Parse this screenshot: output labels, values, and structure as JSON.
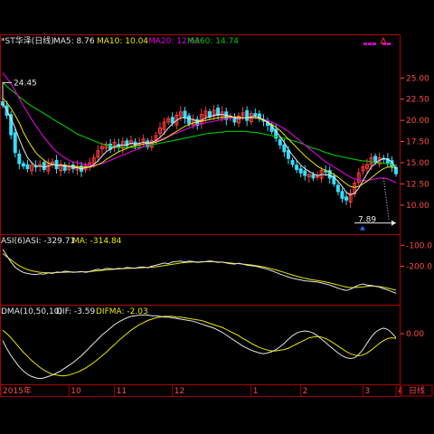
{
  "colors": {
    "up": "#ff3b3b",
    "down": "#32e0ff",
    "frame": "#a80000",
    "axis": "#ff4a4a",
    "white": "#e6e6e6",
    "yellow": "#e8e800",
    "magenta": "#e000e0",
    "green": "#00c800"
  },
  "top": {
    "stock_name": "*ST华泽(日线)",
    "ma_items": [
      {
        "label": "MA5: 8.76",
        "color": "#e6e6e6"
      },
      {
        "label": "MA10: 10.04",
        "color": "#e8e800"
      },
      {
        "label": "MA20: 12.63",
        "color": "#e000e0"
      },
      {
        "label": "MA60: 14.74",
        "color": "#00c800"
      }
    ]
  },
  "asi_panel": {
    "title": "ASI(6)",
    "asi_label": "ASI: -329.71",
    "ma_label": "MA: -314.84"
  },
  "dma_panel": {
    "title": "DMA(10,50,10)",
    "dif_label": "DIF: -3.59",
    "difma_label": "DIFMA: -2.03"
  },
  "x_axis": {
    "labels": [
      "2015年",
      "10",
      "11",
      "12",
      "1",
      "2",
      "3",
      "4"
    ],
    "period_label": "日线"
  },
  "chart_data": [
    {
      "type": "candlestick",
      "title": "*ST华泽(日线)",
      "y_ticks": [
        "25.00",
        "22.50",
        "20.00",
        "17.50",
        "15.00",
        "12.50",
        "10.00"
      ],
      "ylim": [
        7.0,
        27.8
      ],
      "annotations": {
        "high": "24.45",
        "low": "7.89"
      },
      "close": [
        21.8,
        20.6,
        18.3,
        16.2,
        14.9,
        14.6,
        14.3,
        14.7,
        14.5,
        14.8,
        14.2,
        14.9,
        15.1,
        14.3,
        14.8,
        14.1,
        14.5,
        14.3,
        14.6,
        14.0,
        14.7,
        15.0,
        15.6,
        16.4,
        16.9,
        17.2,
        16.6,
        17.4,
        16.8,
        17.5,
        17.0,
        17.6,
        17.1,
        17.3,
        17.8,
        16.9,
        17.6,
        18.2,
        19.1,
        19.8,
        20.2,
        19.7,
        20.6,
        21.0,
        20.3,
        19.6,
        20.1,
        19.4,
        20.7,
        21.1,
        20.4,
        21.2,
        20.6,
        21.0,
        20.1,
        20.5,
        19.8,
        20.5,
        20.9,
        20.0,
        20.8,
        20.6,
        20.3,
        19.9,
        19.4,
        18.7,
        17.9,
        17.1,
        16.3,
        15.5,
        14.8,
        14.2,
        13.8,
        13.5,
        13.6,
        13.2,
        13.4,
        14.1,
        14.0,
        13.2,
        12.5,
        11.6,
        10.8,
        10.6,
        11.4,
        12.6,
        13.8,
        14.5,
        14.8,
        15.6,
        15.1,
        15.6,
        15.4,
        15.0,
        14.6,
        13.7
      ],
      "ma5": [
        21.9,
        21.2,
        20.2,
        19.1,
        17.8,
        16.6,
        15.6,
        15.0,
        14.6,
        14.6,
        14.5,
        14.6,
        14.8,
        14.7,
        14.7,
        14.6,
        14.6,
        14.5,
        14.4,
        14.3,
        14.4,
        14.5,
        14.8,
        15.2,
        15.8,
        16.3,
        16.6,
        16.9,
        17.0,
        17.1,
        17.1,
        17.3,
        17.2,
        17.3,
        17.4,
        17.3,
        17.4,
        17.6,
        18.0,
        18.5,
        19.1,
        19.6,
        20.0,
        20.3,
        20.3,
        20.2,
        20.1,
        19.9,
        20.0,
        20.3,
        20.4,
        20.6,
        20.7,
        20.7,
        20.6,
        20.5,
        20.3,
        20.2,
        20.3,
        20.3,
        20.4,
        20.5,
        20.3,
        20.1,
        19.8,
        19.3,
        18.7,
        18.1,
        17.4,
        16.6,
        15.9,
        15.3,
        14.7,
        14.3,
        14.0,
        13.7,
        13.5,
        13.6,
        13.6,
        13.5,
        13.3,
        12.8,
        12.2,
        11.5,
        11.2,
        11.4,
        12.0,
        12.9,
        13.7,
        14.5,
        14.9,
        15.3,
        15.5,
        15.4,
        15.1,
        14.3
      ],
      "ma10": [
        22.6,
        22.1,
        21.4,
        20.6,
        19.7,
        18.6,
        17.7,
        16.9,
        16.2,
        15.7,
        15.3,
        15.0,
        14.8,
        14.7,
        14.7,
        14.7,
        14.6,
        14.6,
        14.5,
        14.5,
        14.5,
        14.5,
        14.6,
        14.8,
        15.0,
        15.4,
        15.7,
        16.0,
        16.3,
        16.5,
        16.7,
        16.9,
        17.0,
        17.1,
        17.2,
        17.3,
        17.3,
        17.4,
        17.6,
        17.8,
        18.1,
        18.4,
        18.7,
        19.0,
        19.3,
        19.5,
        19.7,
        19.8,
        19.9,
        20.0,
        20.1,
        20.2,
        20.3,
        20.3,
        20.4,
        20.4,
        20.4,
        20.4,
        20.3,
        20.3,
        20.3,
        20.3,
        20.2,
        20.0,
        19.8,
        19.5,
        19.2,
        18.8,
        18.3,
        17.8,
        17.3,
        16.8,
        16.3,
        15.8,
        15.4,
        15.0,
        14.6,
        14.3,
        14.1,
        13.9,
        13.6,
        13.3,
        12.9,
        12.5,
        12.2,
        12.1,
        12.2,
        12.5,
        12.8,
        13.2,
        13.6,
        14.0,
        14.3,
        14.5,
        14.5,
        14.3
      ],
      "ma20": [
        25.6,
        25.0,
        24.3,
        23.5,
        22.6,
        21.7,
        20.9,
        20.1,
        19.4,
        18.7,
        18.0,
        17.4,
        16.8,
        16.3,
        15.9,
        15.6,
        15.3,
        15.1,
        15.0,
        14.9,
        14.8,
        14.7,
        14.7,
        14.8,
        14.9,
        15.1,
        15.3,
        15.5,
        15.7,
        15.9,
        16.1,
        16.3,
        16.5,
        16.7,
        16.9,
        17.1,
        17.3,
        17.5,
        17.7,
        17.9,
        18.1,
        18.3,
        18.5,
        18.7,
        18.9,
        19.1,
        19.3,
        19.5,
        19.6,
        19.7,
        19.8,
        19.9,
        20.0,
        20.1,
        20.2,
        20.3,
        20.3,
        20.3,
        20.3,
        20.3,
        20.3,
        20.3,
        20.2,
        20.1,
        20.0,
        19.8,
        19.6,
        19.3,
        19.0,
        18.7,
        18.3,
        17.9,
        17.5,
        17.1,
        16.7,
        16.3,
        15.9,
        15.5,
        15.1,
        14.8,
        14.5,
        14.2,
        13.9,
        13.6,
        13.3,
        13.1,
        13.0,
        12.9,
        12.9,
        13.0,
        13.1,
        13.2,
        13.2,
        13.1,
        12.9,
        12.6
      ],
      "ma60": [
        24.5,
        24.0,
        23.6,
        23.2,
        22.8,
        22.4,
        22.0,
        21.7,
        21.4,
        21.1,
        20.8,
        20.5,
        20.2,
        19.9,
        19.6,
        19.3,
        19.0,
        18.7,
        18.4,
        18.2,
        18.0,
        17.8,
        17.6,
        17.4,
        17.2,
        17.1,
        17.0,
        16.9,
        16.8,
        16.8,
        16.8,
        16.8,
        16.8,
        16.8,
        16.9,
        17.0,
        17.1,
        17.2,
        17.3,
        17.4,
        17.5,
        17.6,
        17.7,
        17.8,
        17.9,
        18.0,
        18.1,
        18.2,
        18.3,
        18.4,
        18.5,
        18.5,
        18.6,
        18.6,
        18.7,
        18.7,
        18.7,
        18.7,
        18.7,
        18.7,
        18.6,
        18.6,
        18.5,
        18.4,
        18.3,
        18.2,
        18.1,
        18.0,
        17.9,
        17.8,
        17.6,
        17.5,
        17.3,
        17.1,
        16.9,
        16.7,
        16.6,
        16.4,
        16.2,
        16.1,
        15.9,
        15.8,
        15.7,
        15.6,
        15.5,
        15.4,
        15.3,
        15.2,
        15.2,
        15.1,
        15.0,
        15.0,
        14.9,
        14.9,
        14.8,
        14.7
      ]
    },
    {
      "type": "line",
      "title": "ASI(6)",
      "y_ticks": [
        "-100.0",
        "-200.0"
      ],
      "ylim": [
        -380,
        -60
      ],
      "series": [
        {
          "name": "ASI",
          "values": [
            -120,
            -150,
            -180,
            -205,
            -220,
            -230,
            -235,
            -238,
            -240,
            -236,
            -238,
            -232,
            -235,
            -228,
            -230,
            -224,
            -226,
            -230,
            -228,
            -225,
            -230,
            -226,
            -220,
            -215,
            -218,
            -210,
            -212,
            -214,
            -210,
            -212,
            -206,
            -208,
            -210,
            -205,
            -204,
            -208,
            -200,
            -196,
            -190,
            -185,
            -188,
            -180,
            -178,
            -176,
            -180,
            -176,
            -178,
            -182,
            -180,
            -178,
            -175,
            -178,
            -182,
            -180,
            -185,
            -188,
            -190,
            -186,
            -190,
            -195,
            -198,
            -200,
            -205,
            -210,
            -215,
            -222,
            -230,
            -238,
            -245,
            -252,
            -258,
            -262,
            -266,
            -270,
            -272,
            -274,
            -276,
            -280,
            -285,
            -290,
            -298,
            -305,
            -312,
            -316,
            -310,
            -300,
            -290,
            -285,
            -290,
            -292,
            -296,
            -300,
            -308,
            -314,
            -322,
            -330
          ]
        },
        {
          "name": "MA",
          "values": [
            -140,
            -155,
            -170,
            -185,
            -198,
            -208,
            -216,
            -222,
            -226,
            -229,
            -231,
            -232,
            -232,
            -231,
            -230,
            -229,
            -228,
            -228,
            -228,
            -227,
            -227,
            -226,
            -224,
            -222,
            -220,
            -218,
            -216,
            -215,
            -213,
            -212,
            -211,
            -210,
            -209,
            -208,
            -207,
            -206,
            -205,
            -203,
            -200,
            -197,
            -194,
            -191,
            -188,
            -185,
            -183,
            -181,
            -180,
            -180,
            -180,
            -179,
            -179,
            -179,
            -180,
            -181,
            -183,
            -185,
            -187,
            -188,
            -190,
            -192,
            -194,
            -197,
            -200,
            -204,
            -208,
            -213,
            -218,
            -224,
            -230,
            -236,
            -242,
            -248,
            -253,
            -258,
            -262,
            -266,
            -269,
            -272,
            -276,
            -280,
            -285,
            -290,
            -295,
            -300,
            -302,
            -302,
            -301,
            -299,
            -297,
            -295,
            -296,
            -298,
            -301,
            -305,
            -310,
            -315
          ]
        }
      ]
    },
    {
      "type": "line",
      "title": "DMA(10,50,10)",
      "y_ticks": [
        "0.00"
      ],
      "ylim": [
        -7.2,
        3.8
      ],
      "series": [
        {
          "name": "DIF",
          "values": [
            -1.0,
            -2.2,
            -3.2,
            -4.0,
            -4.8,
            -5.4,
            -5.9,
            -6.2,
            -6.4,
            -6.5,
            -6.4,
            -6.2,
            -6.0,
            -5.7,
            -5.4,
            -5.0,
            -4.6,
            -4.2,
            -3.7,
            -3.2,
            -2.6,
            -2.0,
            -1.4,
            -0.8,
            -0.2,
            0.3,
            0.8,
            1.3,
            1.7,
            2.0,
            2.3,
            2.5,
            2.6,
            2.7,
            2.7,
            2.7,
            2.6,
            2.6,
            2.5,
            2.4,
            2.4,
            2.3,
            2.2,
            2.1,
            2.0,
            1.9,
            1.8,
            1.6,
            1.4,
            1.2,
            1.0,
            0.8,
            0.5,
            0.2,
            -0.2,
            -0.6,
            -1.0,
            -1.4,
            -1.8,
            -2.1,
            -2.4,
            -2.6,
            -2.8,
            -2.9,
            -2.8,
            -2.6,
            -2.3,
            -1.9,
            -1.4,
            -0.8,
            -0.3,
            0.1,
            0.3,
            0.4,
            0.3,
            0.1,
            -0.3,
            -0.8,
            -1.3,
            -1.8,
            -2.3,
            -2.8,
            -3.2,
            -3.5,
            -3.6,
            -3.5,
            -3.0,
            -2.3,
            -1.4,
            -0.5,
            0.2,
            0.6,
            0.8,
            0.6,
            0.1,
            -0.6
          ]
        },
        {
          "name": "DIFMA",
          "values": [
            0.5,
            0.0,
            -0.6,
            -1.3,
            -2.0,
            -2.7,
            -3.3,
            -3.9,
            -4.4,
            -4.9,
            -5.3,
            -5.6,
            -5.9,
            -6.0,
            -6.1,
            -6.1,
            -6.0,
            -5.8,
            -5.6,
            -5.3,
            -5.0,
            -4.6,
            -4.2,
            -3.7,
            -3.2,
            -2.7,
            -2.1,
            -1.6,
            -1.0,
            -0.5,
            0.0,
            0.5,
            0.9,
            1.3,
            1.6,
            1.9,
            2.1,
            2.3,
            2.4,
            2.5,
            2.5,
            2.5,
            2.4,
            2.4,
            2.3,
            2.2,
            2.1,
            2.0,
            1.9,
            1.7,
            1.5,
            1.3,
            1.1,
            0.9,
            0.6,
            0.3,
            0.0,
            -0.3,
            -0.7,
            -1.0,
            -1.4,
            -1.7,
            -2.0,
            -2.2,
            -2.4,
            -2.5,
            -2.5,
            -2.4,
            -2.3,
            -2.1,
            -1.8,
            -1.5,
            -1.2,
            -0.9,
            -0.6,
            -0.5,
            -0.4,
            -0.5,
            -0.7,
            -1.0,
            -1.4,
            -1.8,
            -2.2,
            -2.6,
            -2.9,
            -3.1,
            -3.2,
            -3.1,
            -2.8,
            -2.4,
            -1.9,
            -1.4,
            -1.0,
            -0.7,
            -0.6,
            -0.7
          ]
        }
      ]
    }
  ]
}
